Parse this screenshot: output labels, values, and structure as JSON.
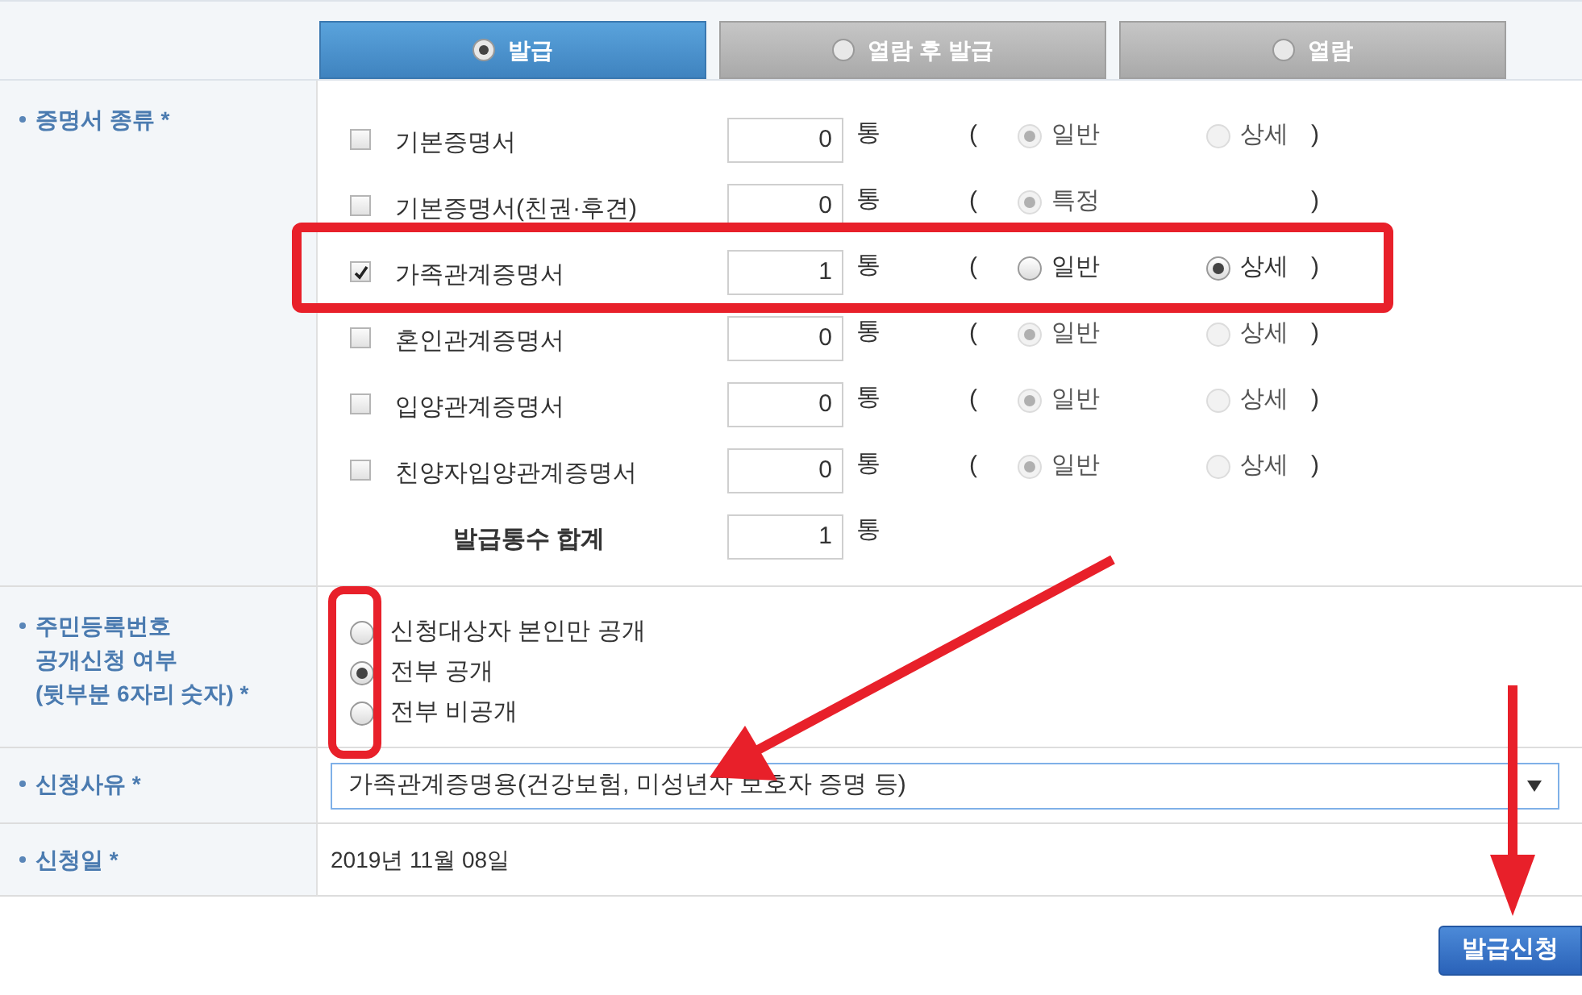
{
  "tabs": [
    {
      "label": "발급",
      "selected": true
    },
    {
      "label": "열람 후 발급",
      "selected": false
    },
    {
      "label": "열람",
      "selected": false
    }
  ],
  "certificate_section": {
    "label": "증명서 종류 *",
    "rows": [
      {
        "name": "기본증명서",
        "checked": false,
        "count": "0",
        "unit": "통",
        "open_paren": "(",
        "close_paren": ")",
        "options": [
          {
            "label": "일반",
            "selected": true,
            "disabled": true
          },
          {
            "label": "상세",
            "selected": false,
            "disabled": true
          }
        ]
      },
      {
        "name": "기본증명서(친권·후견)",
        "checked": false,
        "count": "0",
        "unit": "통",
        "open_paren": "(",
        "close_paren": ")",
        "options": [
          {
            "label": "특정",
            "selected": true,
            "disabled": true
          }
        ]
      },
      {
        "name": "가족관계증명서",
        "checked": true,
        "count": "1",
        "unit": "통",
        "open_paren": "(",
        "close_paren": ")",
        "options": [
          {
            "label": "일반",
            "selected": false,
            "disabled": false
          },
          {
            "label": "상세",
            "selected": true,
            "disabled": false
          }
        ]
      },
      {
        "name": "혼인관계증명서",
        "checked": false,
        "count": "0",
        "unit": "통",
        "open_paren": "(",
        "close_paren": ")",
        "options": [
          {
            "label": "일반",
            "selected": true,
            "disabled": true
          },
          {
            "label": "상세",
            "selected": false,
            "disabled": true
          }
        ]
      },
      {
        "name": "입양관계증명서",
        "checked": false,
        "count": "0",
        "unit": "통",
        "open_paren": "(",
        "close_paren": ")",
        "options": [
          {
            "label": "일반",
            "selected": true,
            "disabled": true
          },
          {
            "label": "상세",
            "selected": false,
            "disabled": true
          }
        ]
      },
      {
        "name": "친양자입양관계증명서",
        "checked": false,
        "count": "0",
        "unit": "통",
        "open_paren": "(",
        "close_paren": ")",
        "options": [
          {
            "label": "일반",
            "selected": true,
            "disabled": true
          },
          {
            "label": "상세",
            "selected": false,
            "disabled": true
          }
        ]
      }
    ],
    "total": {
      "label": "발급통수 합계",
      "count": "1",
      "unit": "통"
    }
  },
  "disclosure_section": {
    "label": "주민등록번호\n공개신청 여부\n(뒷부분 6자리 숫자) *",
    "options": [
      {
        "label": "신청대상자 본인만 공개",
        "selected": false
      },
      {
        "label": "전부 공개",
        "selected": true
      },
      {
        "label": "전부 비공개",
        "selected": false
      }
    ]
  },
  "reason_section": {
    "label": "신청사유 *",
    "value": "가족관계증명용(건강보험, 미성년자 보호자 증명 등)"
  },
  "date_section": {
    "label": "신청일 *",
    "value": "2019년 11월 08일"
  },
  "submit_button": "발급신청"
}
